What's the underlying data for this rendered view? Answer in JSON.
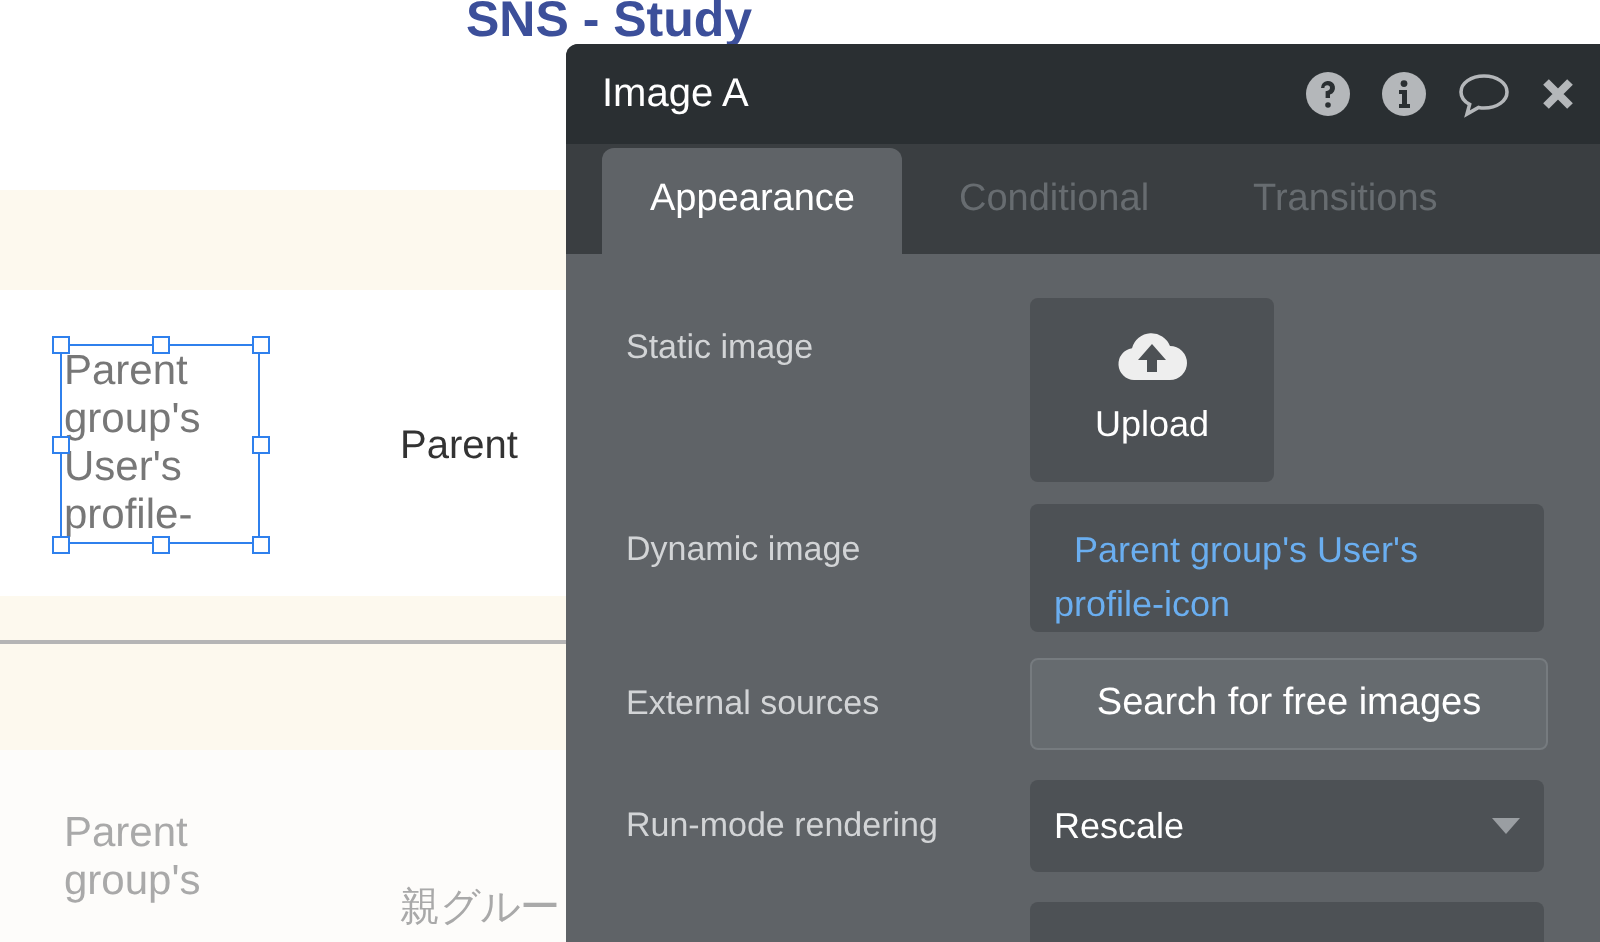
{
  "canvas": {
    "title": "SNS - Study",
    "rows": [
      {
        "image_text": "Parent group's User's profile-",
        "selected": true,
        "faded": false,
        "name_text": "Parent"
      },
      {
        "image_text": "Parent group's",
        "selected": false,
        "faded": true,
        "name_text": "親グルー"
      }
    ]
  },
  "panel": {
    "title": "Image A",
    "tabs": [
      {
        "label": "Appearance",
        "selected": true
      },
      {
        "label": "Conditional",
        "selected": false
      },
      {
        "label": "Transitions",
        "selected": false
      }
    ],
    "properties": [
      {
        "kind": "upload",
        "label": "Static image",
        "value": "Upload"
      },
      {
        "kind": "dynamic",
        "label": "Dynamic image",
        "value": "Parent group's User's profile-icon"
      },
      {
        "kind": "button",
        "label": "External sources",
        "value": "Search for free images"
      },
      {
        "kind": "select",
        "label": "Run-mode rendering",
        "value": "Rescale"
      }
    ]
  }
}
